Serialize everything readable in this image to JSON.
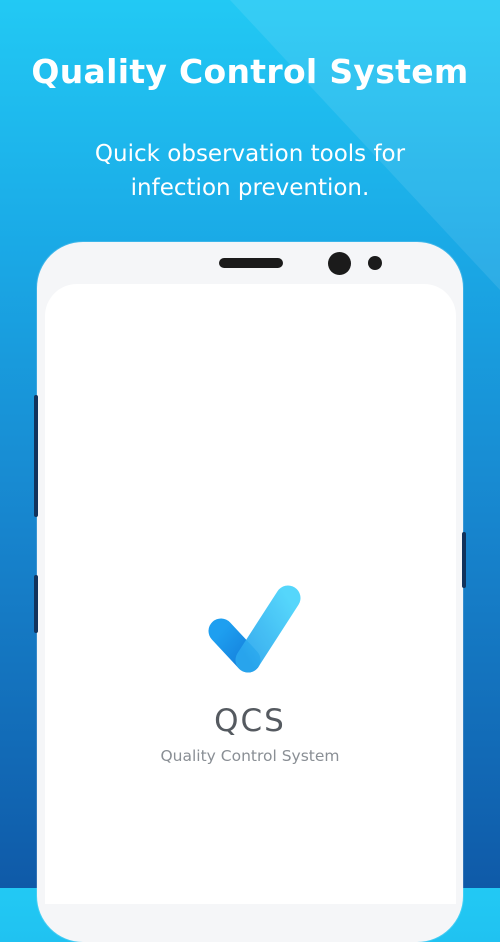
{
  "promo": {
    "headline": "Quality Control System",
    "subhead": "Quick observation tools for infection prevention."
  },
  "app": {
    "name": "QCS",
    "tagline": "Quality Control System",
    "logo_icon": "checkmark-icon"
  },
  "colors": {
    "background_top": "#22c9f4",
    "background_bottom": "#0f5aa8",
    "phone_frame": "#f5f6f8",
    "logo_light": "#3fd0f8",
    "logo_dark": "#1a8fe6"
  }
}
